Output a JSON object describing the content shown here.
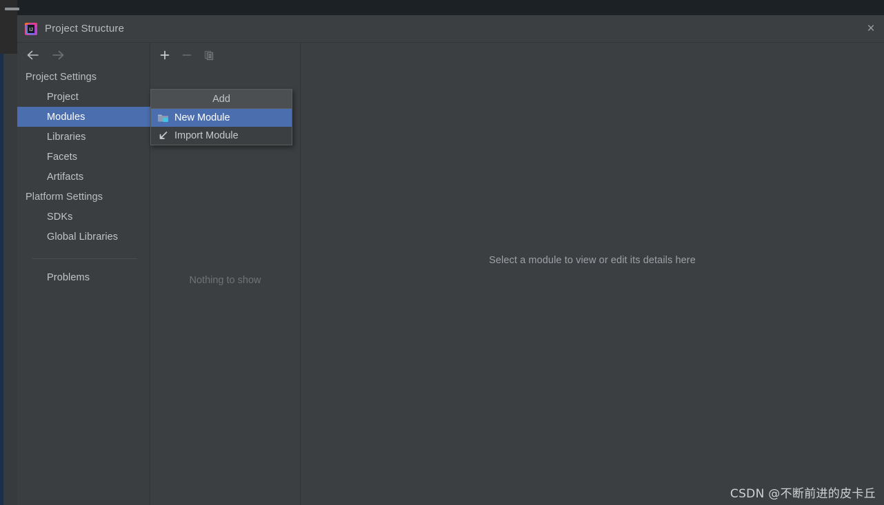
{
  "window": {
    "title": "Project Structure",
    "app_icon": "intellij-idea-logo",
    "close_label": "×"
  },
  "taskbar": {
    "minimize_icon": "minimize-bar"
  },
  "navigation": {
    "back_icon": "arrow-left-icon",
    "forward_icon": "arrow-right-icon"
  },
  "sidebar": {
    "groups": [
      {
        "label": "Project Settings",
        "items": [
          {
            "label": "Project",
            "selected": false
          },
          {
            "label": "Modules",
            "selected": true
          },
          {
            "label": "Libraries",
            "selected": false
          },
          {
            "label": "Facets",
            "selected": false
          },
          {
            "label": "Artifacts",
            "selected": false
          }
        ]
      },
      {
        "label": "Platform Settings",
        "items": [
          {
            "label": "SDKs",
            "selected": false
          },
          {
            "label": "Global Libraries",
            "selected": false
          }
        ]
      }
    ],
    "footer_items": [
      {
        "label": "Problems",
        "selected": false
      }
    ]
  },
  "module_panel": {
    "toolbar": [
      {
        "name": "add-button",
        "icon": "plus-icon",
        "enabled": true
      },
      {
        "name": "remove-button",
        "icon": "minus-icon",
        "enabled": false
      },
      {
        "name": "copy-button",
        "icon": "copy-icon",
        "enabled": false
      }
    ],
    "empty_label": "Nothing to show"
  },
  "add_menu": {
    "header": "Add",
    "items": [
      {
        "label": "New Module",
        "icon": "new-folder-icon",
        "highlighted": true
      },
      {
        "label": "Import Module",
        "icon": "import-arrow-icon",
        "highlighted": false
      }
    ]
  },
  "details": {
    "placeholder": "Select a module to view or edit its details here"
  },
  "watermark": {
    "text": "CSDN @不断前进的皮卡丘"
  },
  "colors": {
    "dialog_bg": "#3c3f41",
    "sidebar_bg": "#3b3e41",
    "selection_blue": "#4b6eaf",
    "menu_header_bg": "#4b4f52",
    "text_primary": "#c2c5c7",
    "text_dim": "#6f7376",
    "desktop_bg": "#22282d"
  }
}
